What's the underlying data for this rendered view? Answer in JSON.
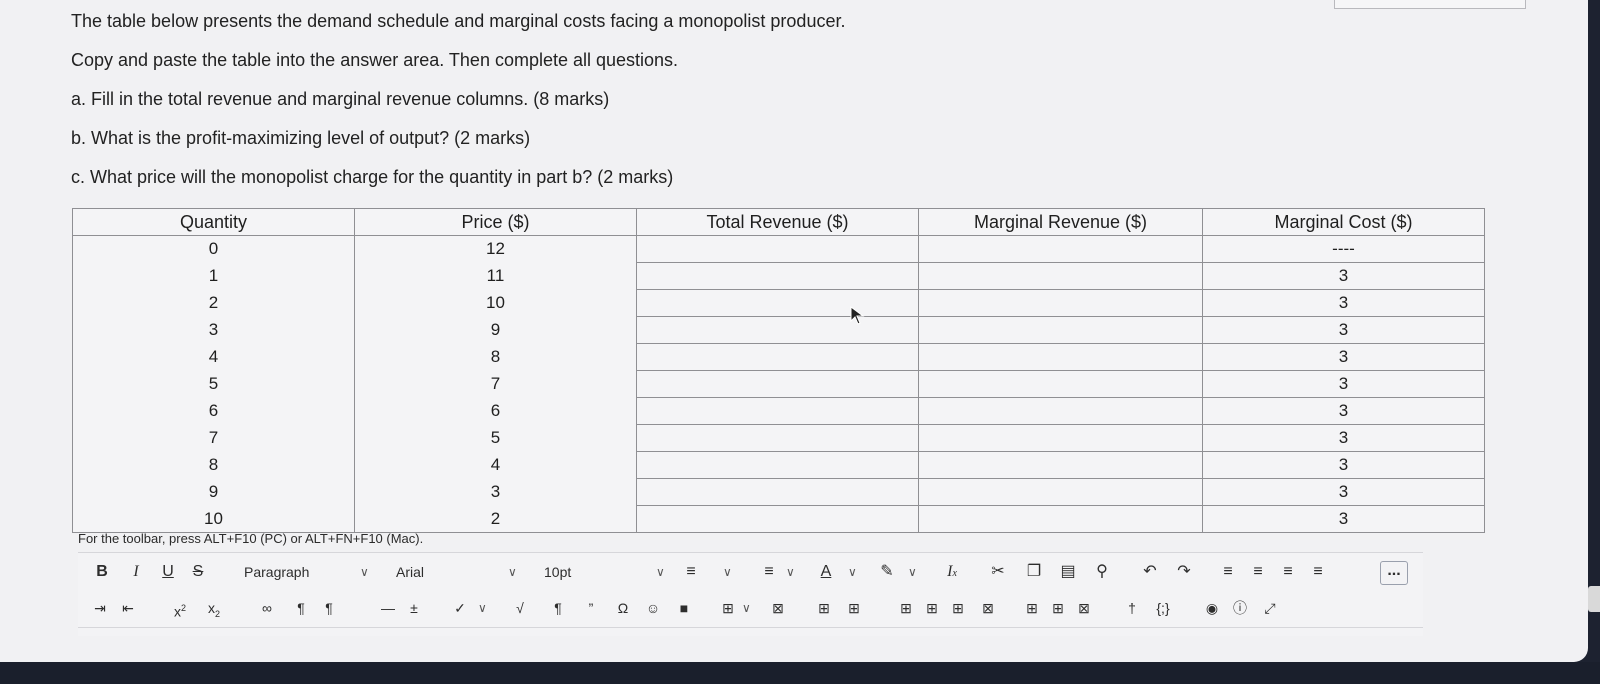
{
  "instructions": {
    "line1": "The table below presents the demand schedule and marginal costs facing a monopolist producer.",
    "line2": "Copy and paste the table into the answer area.  Then complete all questions.",
    "line3": "a. Fill in the total revenue and marginal revenue columns. (8 marks)",
    "line4": "b. What is the profit-maximizing level of output? (2 marks)",
    "line5": "c. What price will the monopolist charge for the quantity in part b? (2 marks)"
  },
  "table": {
    "headers": [
      "Quantity",
      "Price ($)",
      "Total Revenue ($)",
      "Marginal Revenue ($)",
      "Marginal Cost ($)"
    ],
    "rows": [
      {
        "q": "0",
        "p": "12",
        "tr": "",
        "mr": "",
        "mc": "----"
      },
      {
        "q": "1",
        "p": "11",
        "tr": "",
        "mr": "",
        "mc": "3"
      },
      {
        "q": "2",
        "p": "10",
        "tr": "",
        "mr": "",
        "mc": "3"
      },
      {
        "q": "3",
        "p": "9",
        "tr": "",
        "mr": "",
        "mc": "3"
      },
      {
        "q": "4",
        "p": "8",
        "tr": "",
        "mr": "",
        "mc": "3"
      },
      {
        "q": "5",
        "p": "7",
        "tr": "",
        "mr": "",
        "mc": "3"
      },
      {
        "q": "6",
        "p": "6",
        "tr": "",
        "mr": "",
        "mc": "3"
      },
      {
        "q": "7",
        "p": "5",
        "tr": "",
        "mr": "",
        "mc": "3"
      },
      {
        "q": "8",
        "p": "4",
        "tr": "",
        "mr": "",
        "mc": "3"
      },
      {
        "q": "9",
        "p": "3",
        "tr": "",
        "mr": "",
        "mc": "3"
      },
      {
        "q": "10",
        "p": "2",
        "tr": "",
        "mr": "",
        "mc": "3"
      }
    ]
  },
  "editor": {
    "hint": "For the toolbar, press ALT+F10 (PC) or ALT+FN+F10 (Mac).",
    "bold": "B",
    "italic": "I",
    "underline": "U",
    "strike": "S",
    "paragraph": "Paragraph",
    "font": "Arial",
    "size": "10pt",
    "more": "...",
    "icons": {
      "row1": [
        "chevron-down-icon",
        "bullet-list-icon",
        "numbered-list-icon",
        "text-color-icon",
        "highlight-icon",
        "clear-format-icon",
        "cut-icon",
        "copy-icon",
        "paste-icon",
        "find-icon",
        "undo-icon",
        "redo-icon",
        "align-left-icon",
        "align-center-icon",
        "align-right-icon",
        "justify-icon",
        "more-icon"
      ],
      "row2": [
        "indent-icon",
        "outdent-icon",
        "superscript-icon",
        "subscript-icon",
        "unlink-icon",
        "ltr-icon",
        "rtl-icon",
        "horizontal-rule-icon",
        "plus-minus-icon",
        "spellcheck-icon",
        "math-icon",
        "paragraph-mark-icon",
        "quote-icon",
        "omega-icon",
        "emoji-icon",
        "bookmark-icon",
        "table-icon",
        "delete-table-icon",
        "table-row-icons",
        "accessibility-icon",
        "code-icon",
        "preview-icon",
        "help-icon",
        "fullscreen-icon"
      ]
    }
  }
}
